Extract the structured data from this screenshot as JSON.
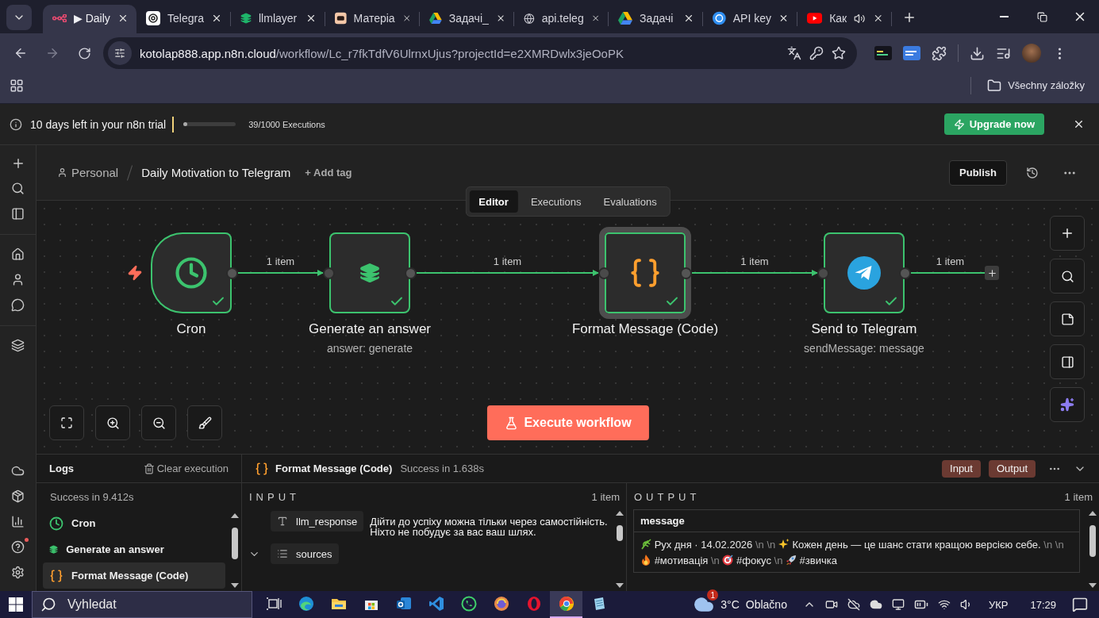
{
  "browser": {
    "tabs": [
      {
        "kind": "workflow",
        "title": "▶ Daily",
        "selected": true,
        "audio": false
      },
      {
        "kind": "chat-ai",
        "title": "Telegra",
        "selected": false,
        "audio": false
      },
      {
        "kind": "layers",
        "title": "llmlayer",
        "selected": false,
        "audio": false
      },
      {
        "kind": "box",
        "title": "Матеріа",
        "selected": false,
        "audio": false
      },
      {
        "kind": "drive",
        "title": "Задачі_",
        "selected": false,
        "audio": false
      },
      {
        "kind": "globe",
        "title": "api.teleg",
        "selected": false,
        "audio": false
      },
      {
        "kind": "drive",
        "title": "Задачі",
        "selected": false,
        "audio": false
      },
      {
        "kind": "ai",
        "title": "API key",
        "selected": false,
        "audio": false
      },
      {
        "kind": "video",
        "title": "Как",
        "selected": false,
        "audio": true
      }
    ],
    "address": {
      "host": "kotolap888.app.n8n.cloud",
      "path": "/workflow/Lc_r7fkTdfV6UlrnxUjus?projectId=e2XMRDwlx3jeOoPK"
    },
    "bookmarks": {
      "all_label": "Všechny záložky"
    }
  },
  "trial": {
    "message": "10 days left in your n8n trial",
    "level": 0.039,
    "executions": "39/1000 Executions",
    "upgrade": "Upgrade now"
  },
  "header": {
    "project": "Personal",
    "workflow": "Daily Motivation to Telegram",
    "add_tag": "+ Add tag",
    "publish": "Publish"
  },
  "view_tabs": [
    {
      "label": "Editor",
      "selected": true
    },
    {
      "label": "Executions",
      "selected": false
    },
    {
      "label": "Evaluations",
      "selected": false
    }
  ],
  "nodes": [
    {
      "kind": "schedule",
      "name": "Cron",
      "executed": true,
      "selected": false
    },
    {
      "kind": "ai",
      "name": "Generate an answer",
      "subtitle": "answer: generate",
      "executed": true,
      "selected": false
    },
    {
      "kind": "code",
      "name": "Format Message (Code)",
      "executed": true,
      "selected": true
    },
    {
      "kind": "telegram",
      "name": "Send to Telegram",
      "subtitle": "sendMessage: message",
      "executed": true,
      "selected": false
    }
  ],
  "connections": [
    {
      "label": "1 item"
    },
    {
      "label": "1 item"
    },
    {
      "label": "1 item"
    },
    {
      "label": "1 item"
    }
  ],
  "execute_button": "Execute workflow",
  "logs": {
    "title": "Logs",
    "clear": "Clear execution",
    "summary": "Success in 9.412s",
    "entries": [
      {
        "kind": "schedule",
        "name": "Cron",
        "selected": false
      },
      {
        "kind": "ai",
        "name": "Generate an answer",
        "selected": false
      },
      {
        "kind": "code",
        "name": "Format Message (Code)",
        "selected": true
      }
    ]
  },
  "detail": {
    "kind": "code",
    "title": "Format Message (Code)",
    "status": "Success in 1.638s",
    "toggles": [
      {
        "label": "Input"
      },
      {
        "label": "Output"
      }
    ],
    "input": {
      "heading": "INPUT",
      "count": "1 item",
      "fields": [
        {
          "kind": "text",
          "name": "llm_response",
          "value": "Дійти до успіху можна тільки через самостійність. Ніхто не побудує за вас ваш шлях."
        },
        {
          "kind": "list",
          "name": "sources",
          "expanded": true
        }
      ]
    },
    "output": {
      "heading": "OUTPUT",
      "count": "1 item",
      "column": "message",
      "segments": [
        {
          "kind": "icon"
        },
        {
          "kind": "text",
          "text": "Рух дня · 14.02.2026"
        },
        {
          "kind": "escape",
          "text": "\\n"
        },
        {
          "kind": "escape",
          "text": "\\n"
        },
        {
          "kind": "icon"
        },
        {
          "kind": "text",
          "text": "Кожен день — це шанс стати кращою версією себе."
        },
        {
          "kind": "escape",
          "text": "\\n"
        },
        {
          "kind": "escape",
          "text": "\\n"
        },
        {
          "kind": "icon"
        },
        {
          "kind": "text",
          "text": "#мотивація"
        },
        {
          "kind": "escape",
          "text": "\\n"
        },
        {
          "kind": "icon"
        },
        {
          "kind": "text",
          "text": "#фокус"
        },
        {
          "kind": "escape",
          "text": "\\n"
        },
        {
          "kind": "icon"
        },
        {
          "kind": "text",
          "text": "#звичка"
        }
      ]
    }
  },
  "taskbar": {
    "search_placeholder": "Vyhledat",
    "apps": [
      {
        "kind": "task-view",
        "selected": false
      },
      {
        "kind": "edge",
        "selected": false
      },
      {
        "kind": "explorer",
        "selected": false
      },
      {
        "kind": "store",
        "selected": false
      },
      {
        "kind": "mail",
        "selected": false
      },
      {
        "kind": "code",
        "selected": false
      },
      {
        "kind": "whatsapp",
        "selected": false
      },
      {
        "kind": "firefox",
        "selected": false
      },
      {
        "kind": "opera",
        "selected": false
      },
      {
        "kind": "chrome",
        "selected": true
      },
      {
        "kind": "notes",
        "selected": false
      }
    ],
    "weather": {
      "badge": "1",
      "temperature": "3°C",
      "condition": "Oblačno"
    },
    "language": "УКР",
    "time": "17:29"
  }
}
